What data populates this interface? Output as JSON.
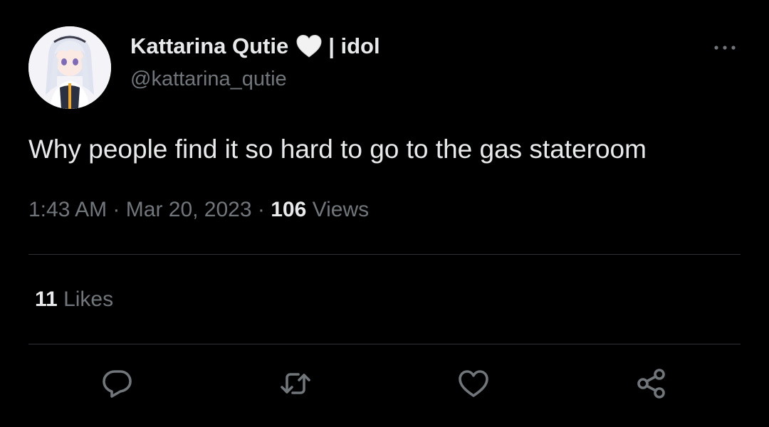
{
  "author": {
    "display_name": "Kattarina Qutie",
    "name_suffix": "| idol",
    "handle": "@kattarina_qutie",
    "badge_icon": "white-heart-icon",
    "avatar_icon": "anime-girl-avatar"
  },
  "tweet": {
    "text": "Why people find it so hard to go to the gas stateroom"
  },
  "meta": {
    "time": "1:43 AM",
    "separator": "·",
    "date": "Mar 20, 2023",
    "views_count": "106",
    "views_label": "Views"
  },
  "stats": {
    "likes_count": "11",
    "likes_label": "Likes"
  },
  "actions": {
    "reply_icon": "reply-icon",
    "retweet_icon": "retweet-icon",
    "like_icon": "heart-icon",
    "share_icon": "share-icon",
    "more_icon": "more-icon"
  },
  "colors": {
    "background": "#000000",
    "primary_text": "#e7e9ea",
    "secondary_text": "#71767b",
    "divider": "#2f3336"
  }
}
